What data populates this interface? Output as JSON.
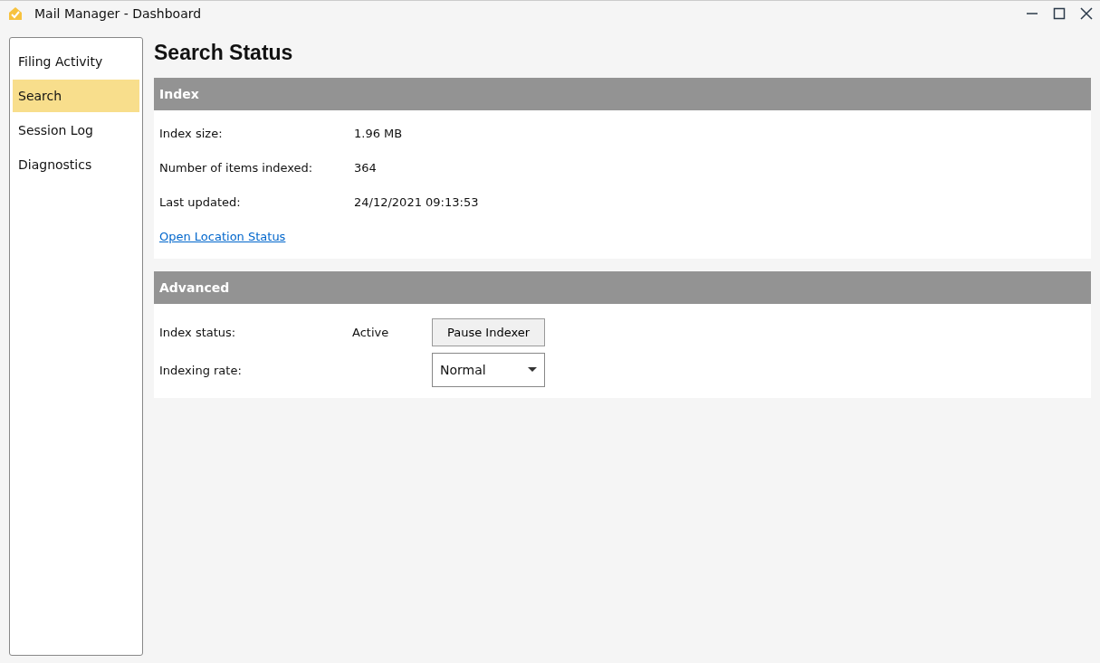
{
  "window": {
    "title": "Mail Manager - Dashboard"
  },
  "sidebar": {
    "items": [
      {
        "label": "Filing Activity",
        "selected": false
      },
      {
        "label": "Search",
        "selected": true
      },
      {
        "label": "Session Log",
        "selected": false
      },
      {
        "label": "Diagnostics",
        "selected": false
      }
    ]
  },
  "page_title": "Search Status",
  "index_section": {
    "title": "Index",
    "rows": [
      {
        "label": "Index size:",
        "value": "1.96 MB"
      },
      {
        "label": "Number of items indexed:",
        "value": "364"
      },
      {
        "label": "Last updated:",
        "value": "24/12/2021 09:13:53"
      }
    ],
    "link": "Open Location Status"
  },
  "advanced_section": {
    "title": "Advanced",
    "index_status": {
      "label": "Index status:",
      "value": "Active",
      "button": "Pause Indexer"
    },
    "indexing_rate": {
      "label": "Indexing rate:",
      "value": "Normal"
    }
  }
}
